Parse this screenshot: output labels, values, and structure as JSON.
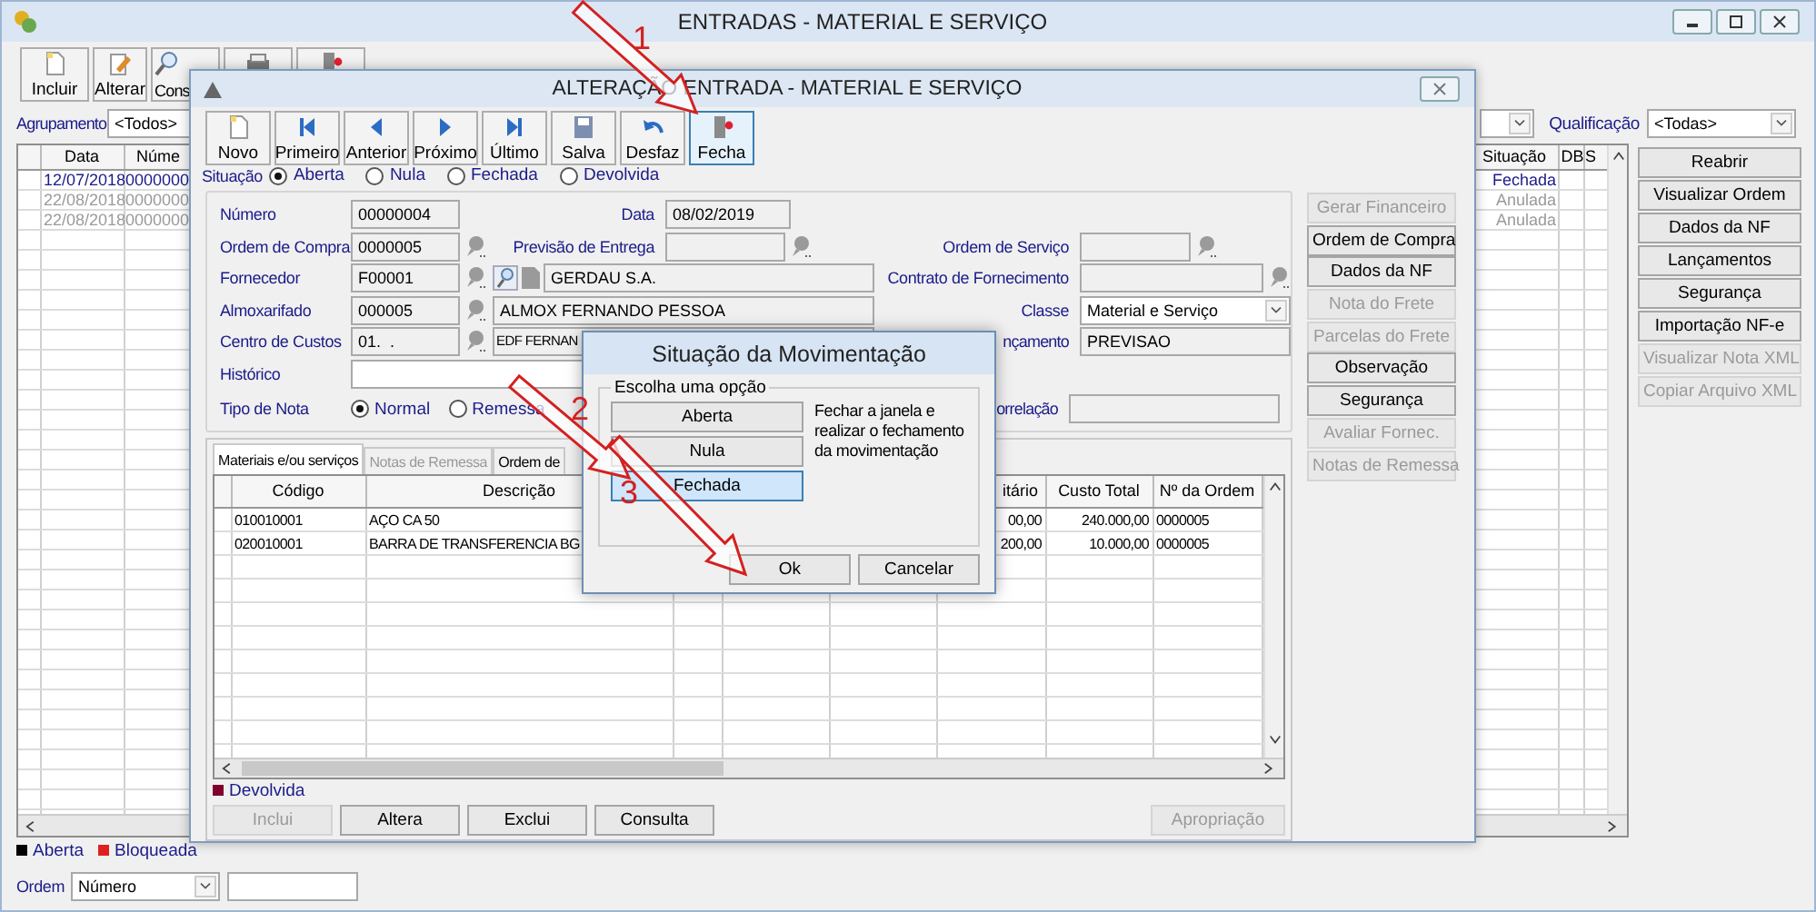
{
  "window": {
    "title": "ENTRADAS - MATERIAL E SERVIÇO"
  },
  "toolbar": [
    {
      "label": "Incluir",
      "kind": "new"
    },
    {
      "label": "Alterar",
      "kind": "edit"
    },
    {
      "label": "Cons",
      "kind": "search"
    },
    {
      "kind": "print"
    },
    {
      "kind": "exit"
    }
  ],
  "filters": {
    "grouping_label": "Agrupamento",
    "grouping_value": "<Todos>",
    "qualification_label": "Qualificação",
    "qualification_value": "<Todas>"
  },
  "list": {
    "columns": [
      "Data",
      "Núme",
      "Situação",
      "DB",
      "S"
    ],
    "rows": [
      {
        "date": "12/07/2018",
        "number": "0000000",
        "status": "Fechada",
        "dimmed": false
      },
      {
        "date": "22/08/2018",
        "number": "0000000",
        "status": "Anulada",
        "dimmed": true
      },
      {
        "date": "22/08/2018",
        "number": "0000000",
        "status": "Anulada",
        "dimmed": true
      }
    ]
  },
  "side_buttons": [
    {
      "label": "Reabrir",
      "disabled": false
    },
    {
      "label": "Visualizar Ordem",
      "disabled": false
    },
    {
      "label": "Dados da NF",
      "disabled": false
    },
    {
      "label": "Lançamentos",
      "disabled": false
    },
    {
      "label": "Segurança",
      "disabled": false
    },
    {
      "label": "Importação NF-e",
      "disabled": false
    },
    {
      "label": "Visualizar Nota XML",
      "disabled": true
    },
    {
      "label": "Copiar Arquivo XML",
      "disabled": true
    }
  ],
  "legend": [
    {
      "label": "Aberta",
      "color": "#000000"
    },
    {
      "label": "Bloqueada",
      "color": "#e02020"
    }
  ],
  "order": {
    "label": "Ordem",
    "value": "Número"
  },
  "dialog": {
    "title": "ALTERAÇÃO ENTRADA - MATERIAL E SERVIÇO",
    "toolbar": [
      {
        "label": "Novo",
        "kind": "new",
        "focused": false
      },
      {
        "label": "Primeiro",
        "kind": "first",
        "focused": false
      },
      {
        "label": "Anterior",
        "kind": "prev",
        "focused": false
      },
      {
        "label": "Próximo",
        "kind": "next",
        "focused": false
      },
      {
        "label": "Último",
        "kind": "last",
        "focused": false
      },
      {
        "label": "Salva",
        "kind": "save",
        "focused": false
      },
      {
        "label": "Desfaz",
        "kind": "undo",
        "focused": false
      },
      {
        "label": "Fecha",
        "kind": "close",
        "focused": true
      }
    ],
    "situation": {
      "label": "Situação",
      "options": [
        {
          "label": "Aberta",
          "selected": true
        },
        {
          "label": "Nula",
          "selected": false
        },
        {
          "label": "Fechada",
          "selected": false
        },
        {
          "label": "Devolvida",
          "selected": false
        }
      ]
    },
    "form": {
      "number": {
        "label": "Número",
        "value": "00000004"
      },
      "date": {
        "label": "Data",
        "value": "08/02/2019"
      },
      "purchase_order": {
        "label": "Ordem de Compra",
        "value": "0000005"
      },
      "delivery_forecast": {
        "label": "Previsão de Entrega"
      },
      "service_order": {
        "label": "Ordem de Serviço"
      },
      "supplier": {
        "label": "Fornecedor",
        "code": "F00001",
        "name": "GERDAU S.A."
      },
      "supply_contract": {
        "label": "Contrato de Fornecimento"
      },
      "warehouse": {
        "label": "Almoxarifado",
        "code": "000005",
        "name": "ALMOX FERNANDO PESSOA"
      },
      "class": {
        "label": "Classe",
        "value": "Material e Serviço"
      },
      "cost_center": {
        "label": "Centro de Custos",
        "code": "01.  .",
        "name": "EDF FERNAN"
      },
      "entry": {
        "label": "nçamento",
        "value": "PREVISAO"
      },
      "history": {
        "label": "Histórico"
      },
      "note_type": {
        "label": "Tipo de Nota",
        "options": [
          {
            "label": "Normal",
            "selected": true
          },
          {
            "label": "Remessa",
            "selected": false
          }
        ]
      },
      "correlation": {
        "label": "orrelação"
      }
    },
    "actions": [
      {
        "label": "Gerar Financeiro",
        "disabled": true
      },
      {
        "label": "Ordem de Compra",
        "disabled": false
      },
      {
        "label": "Dados da NF",
        "disabled": false
      },
      {
        "label": "Nota do Frete",
        "disabled": true
      },
      {
        "label": "Parcelas do Frete",
        "disabled": true
      },
      {
        "label": "Observação",
        "disabled": false
      },
      {
        "label": "Segurança",
        "disabled": false
      },
      {
        "label": "Avaliar Fornec.",
        "disabled": true
      },
      {
        "label": "Notas de Remessa",
        "disabled": true
      }
    ],
    "tabs": [
      {
        "label": "Materiais e/ou serviços",
        "selected": true,
        "disabled": false
      },
      {
        "label": "Notas de Remessa",
        "selected": false,
        "disabled": true
      },
      {
        "label": "Ordem de",
        "selected": false,
        "disabled": false
      }
    ],
    "items": {
      "columns": [
        "Código",
        "Descrição",
        "itário",
        "Custo Total",
        "Nº da Ordem"
      ],
      "rows": [
        {
          "code": "010010001",
          "description": "AÇO CA 50",
          "unit": "00,00",
          "total": "240.000,00",
          "order": "0000005"
        },
        {
          "code": "020010001",
          "description": "BARRA DE TRANSFERENCIA BG",
          "unit": "200,00",
          "total": "10.000,00",
          "order": "0000005"
        }
      ]
    },
    "legend": {
      "label": "Devolvida",
      "color": "#800030"
    },
    "buttons": [
      {
        "label": "Inclui",
        "disabled": true
      },
      {
        "label": "Altera",
        "disabled": false
      },
      {
        "label": "Exclui",
        "disabled": false
      },
      {
        "label": "Consulta",
        "disabled": false
      }
    ],
    "allocation": {
      "label": "Apropriação",
      "disabled": true
    }
  },
  "popup": {
    "title": "Situação da Movimentação",
    "group": "Escolha uma opção",
    "options": [
      {
        "label": "Aberta",
        "selected": false
      },
      {
        "label": "Nula",
        "selected": false
      },
      {
        "label": "Fechada",
        "selected": true
      }
    ],
    "hint": "Fechar a janela e realizar o fechamento da movimentação",
    "ok": "Ok",
    "cancel": "Cancelar"
  },
  "annotations": [
    {
      "number": "1"
    },
    {
      "number": "2"
    },
    {
      "number": "3"
    }
  ]
}
